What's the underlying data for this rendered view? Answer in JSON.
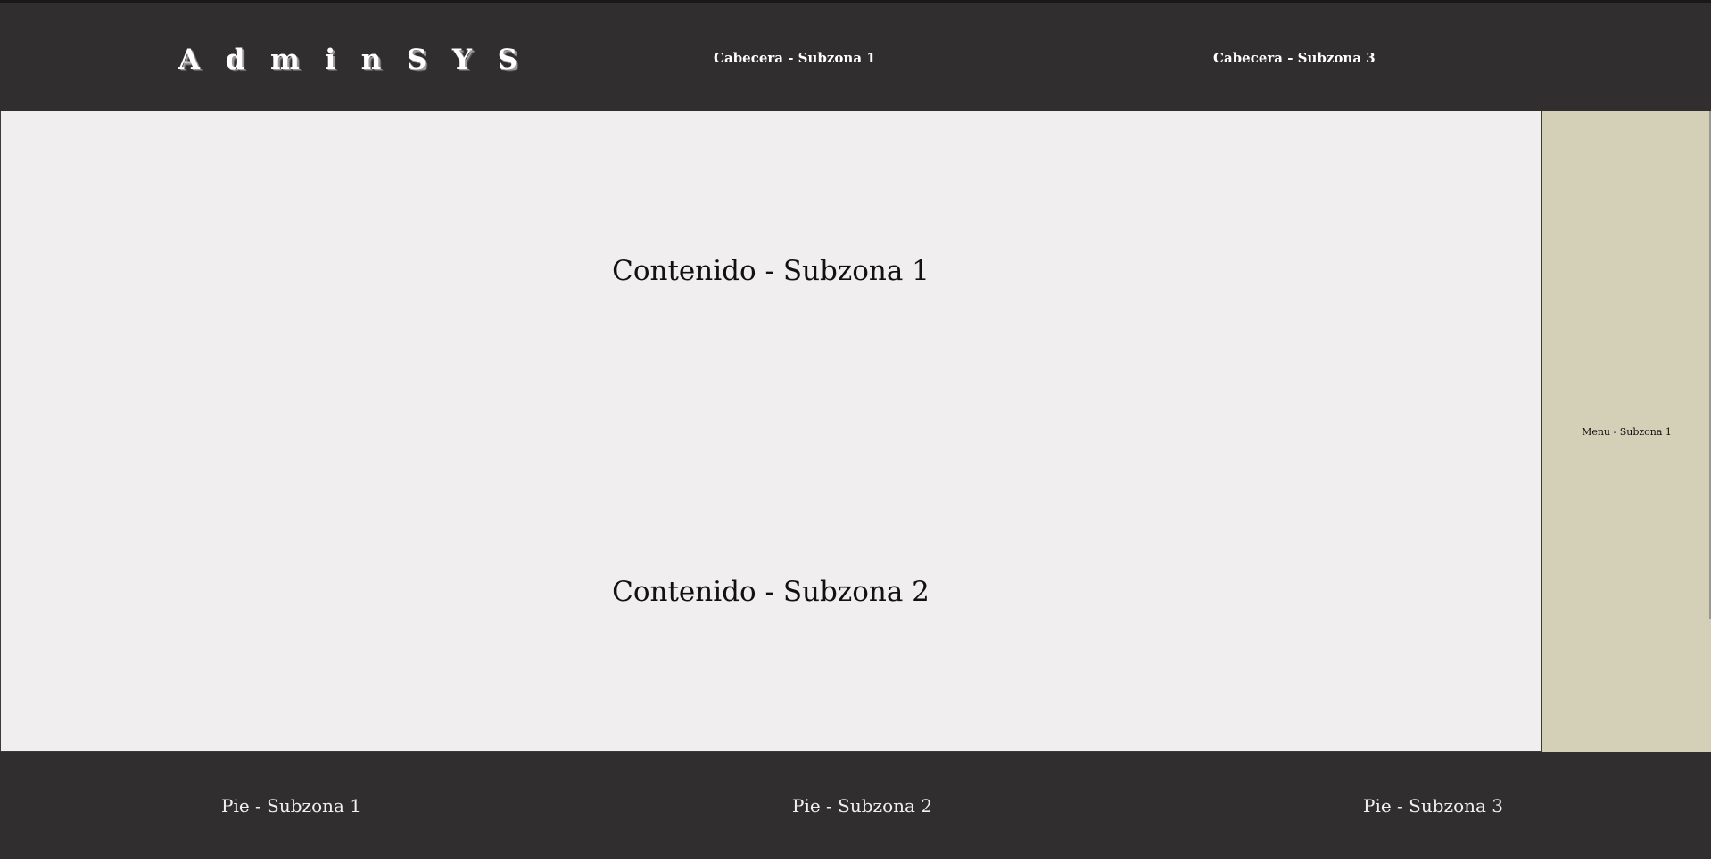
{
  "header": {
    "logo_letters": [
      "A",
      "d",
      "m",
      "i",
      "n",
      "S",
      "Y",
      "S"
    ],
    "subzone_1": "Cabecera - Subzona 1",
    "subzone_3": "Cabecera - Subzona 3"
  },
  "content": {
    "subzone_1": "Contenido - Subzona 1",
    "subzone_2": "Contenido - Subzona 2"
  },
  "menu": {
    "subzone_1": "Menu - Subzona 1"
  },
  "footer": {
    "subzone_1": "Pie - Subzona 1",
    "subzone_2": "Pie - Subzona 2",
    "subzone_3": "Pie - Subzona 3"
  },
  "colors": {
    "header_bg": "#302e2f",
    "content_bg": "#f0eeef",
    "menu_bg": "#d4d0b8",
    "footer_bg": "#302e2f"
  }
}
